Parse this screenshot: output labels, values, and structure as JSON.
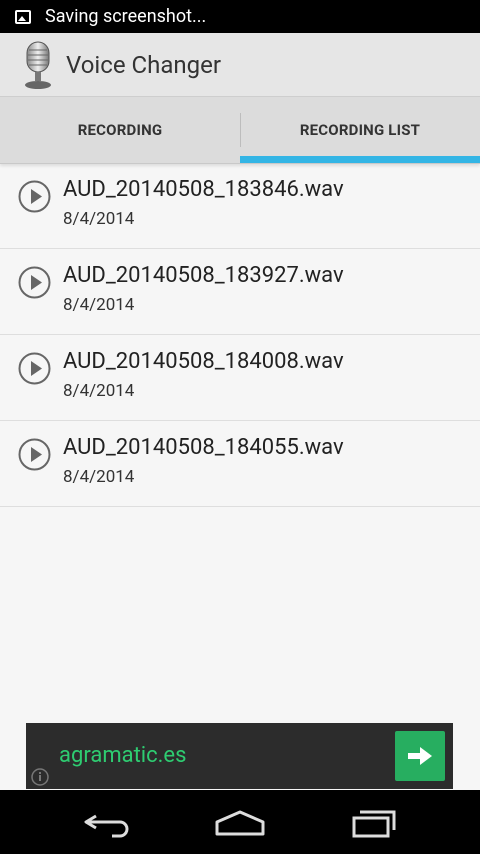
{
  "status_bar": {
    "notification_text": "Saving screenshot...",
    "icon": "image-icon"
  },
  "action_bar": {
    "title": "Voice Changer",
    "icon": "microphone-icon"
  },
  "tabs": [
    {
      "label": "RECORDING",
      "active": false
    },
    {
      "label": "RECORDING LIST",
      "active": true
    }
  ],
  "recordings": [
    {
      "name": "AUD_20140508_183846.wav",
      "date": "8/4/2014"
    },
    {
      "name": "AUD_20140508_183927.wav",
      "date": "8/4/2014"
    },
    {
      "name": "AUD_20140508_184008.wav",
      "date": "8/4/2014"
    },
    {
      "name": "AUD_20140508_184055.wav",
      "date": "8/4/2014"
    }
  ],
  "ad": {
    "text": "agramatic.es",
    "button_icon": "arrow-right-icon",
    "info_icon": "info-icon"
  },
  "nav_bar": {
    "icons": [
      "back-icon",
      "home-icon",
      "recent-apps-icon"
    ]
  },
  "colors": {
    "accent": "#33b5e5",
    "ad_green": "#2ecc71"
  }
}
